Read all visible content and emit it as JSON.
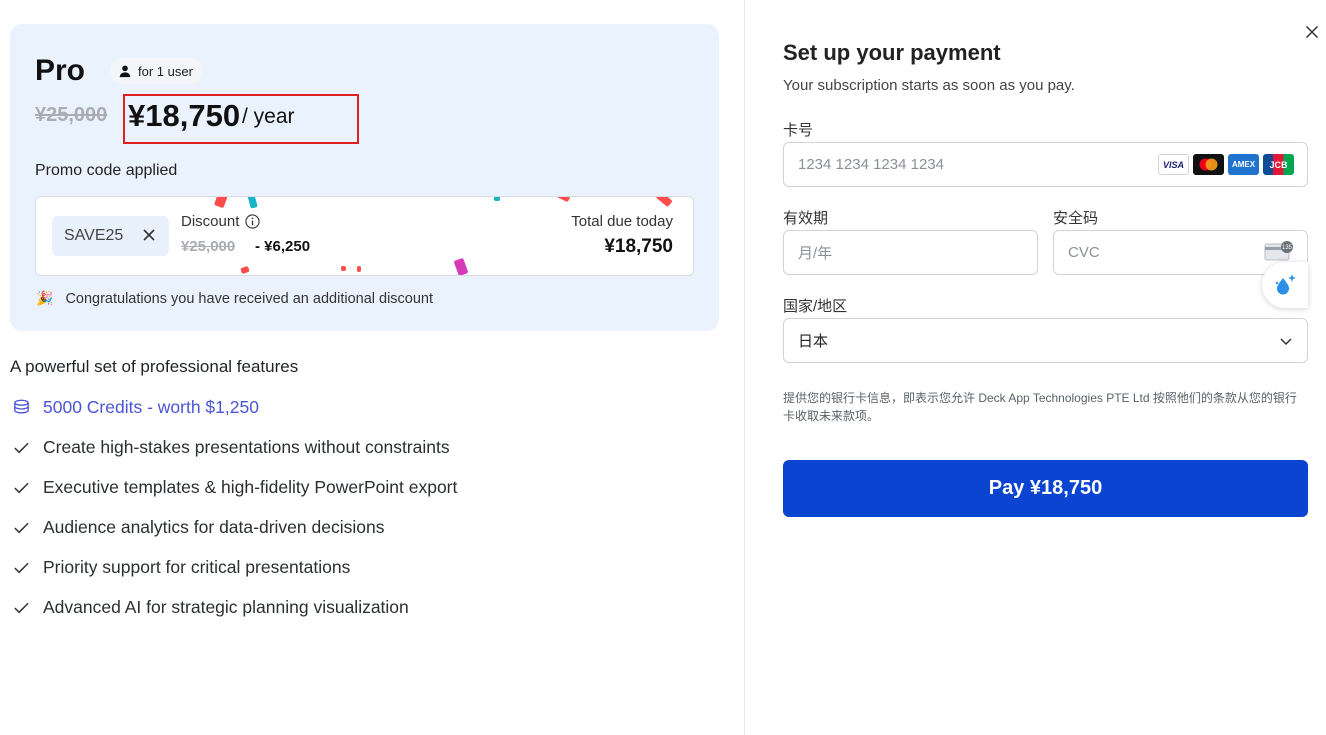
{
  "plan": {
    "name": "Pro",
    "users_badge": "for 1 user",
    "original_price": "¥25,000",
    "price": "¥18,750",
    "period": "/ year",
    "promo_label": "Promo code applied",
    "promo_code": "SAVE25",
    "discount_label": "Discount",
    "discount_original": "¥25,000",
    "discount_amount": "- ¥6,250",
    "total_label": "Total due today",
    "total_value": "¥18,750",
    "congrats_text": "Congratulations you have received an additional discount"
  },
  "features": {
    "title": "A powerful set of professional features",
    "credits": "5000 Credits - worth $1,250",
    "items": [
      "Create high-stakes presentations without constraints",
      "Executive templates & high-fidelity PowerPoint export",
      "Audience analytics for data-driven decisions",
      "Priority support for critical presentations",
      "Advanced AI for strategic planning visualization"
    ]
  },
  "payment": {
    "title": "Set up your payment",
    "subtitle": "Your subscription starts as soon as you pay.",
    "card_number_label": "卡号",
    "card_number_placeholder": "1234 1234 1234 1234",
    "expiry_label": "有效期",
    "expiry_placeholder": "月/年",
    "cvc_label": "安全码",
    "cvc_placeholder": "CVC",
    "country_label": "国家/地区",
    "country_value": "日本",
    "legal_text": "提供您的银行卡信息，即表示您允许 Deck App Technologies PTE Ltd 按照他们的条款从您的银行卡收取未来款项。",
    "pay_button": "Pay ¥18,750",
    "card_brands": [
      "VISA",
      "mastercard",
      "AMEX",
      "JCB"
    ]
  },
  "colors": {
    "accent": "#0a44d0",
    "card_bg": "#eaf3fd",
    "highlight": "#e0201f",
    "credits": "#4a55d6"
  }
}
